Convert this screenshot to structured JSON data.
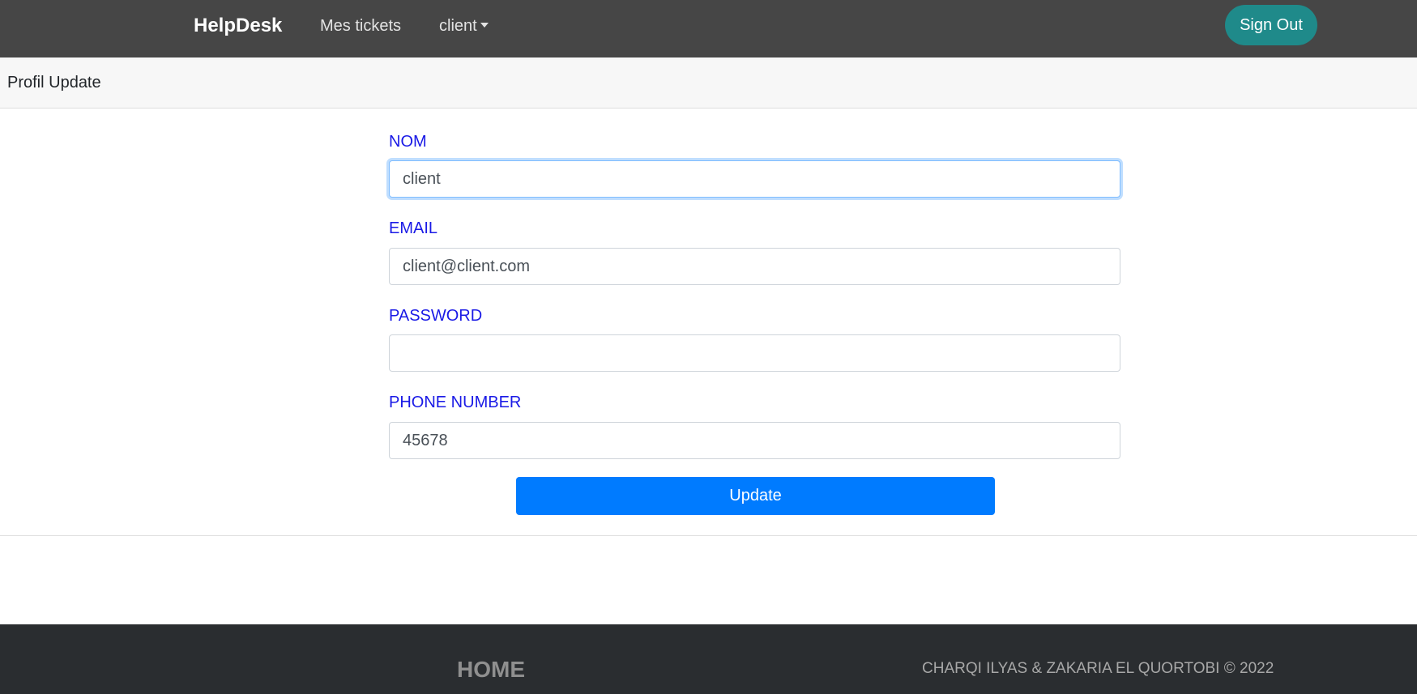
{
  "navbar": {
    "brand": "HelpDesk",
    "links": {
      "tickets": "Mes tickets",
      "client": "client"
    },
    "signout_label": "Sign Out"
  },
  "subheader": {
    "title": "Profil Update"
  },
  "form": {
    "nom": {
      "label": "NOM",
      "value": "client"
    },
    "email": {
      "label": "EMAIL",
      "value": "client@client.com"
    },
    "password": {
      "label": "PASSWORD",
      "value": ""
    },
    "phone": {
      "label": "PHONE NUMBER",
      "value": "45678"
    },
    "submit_label": "Update"
  },
  "footer": {
    "home": "HOME",
    "copyright": "CHARQI ILYAS & ZAKARIA EL QUORTOBI © 2022"
  },
  "colors": {
    "navbar_bg": "#464646",
    "signout_bg": "#1f8a8a",
    "label_color": "#1a1ae6",
    "primary": "#007bff",
    "footer_bg": "#2a2d30"
  }
}
